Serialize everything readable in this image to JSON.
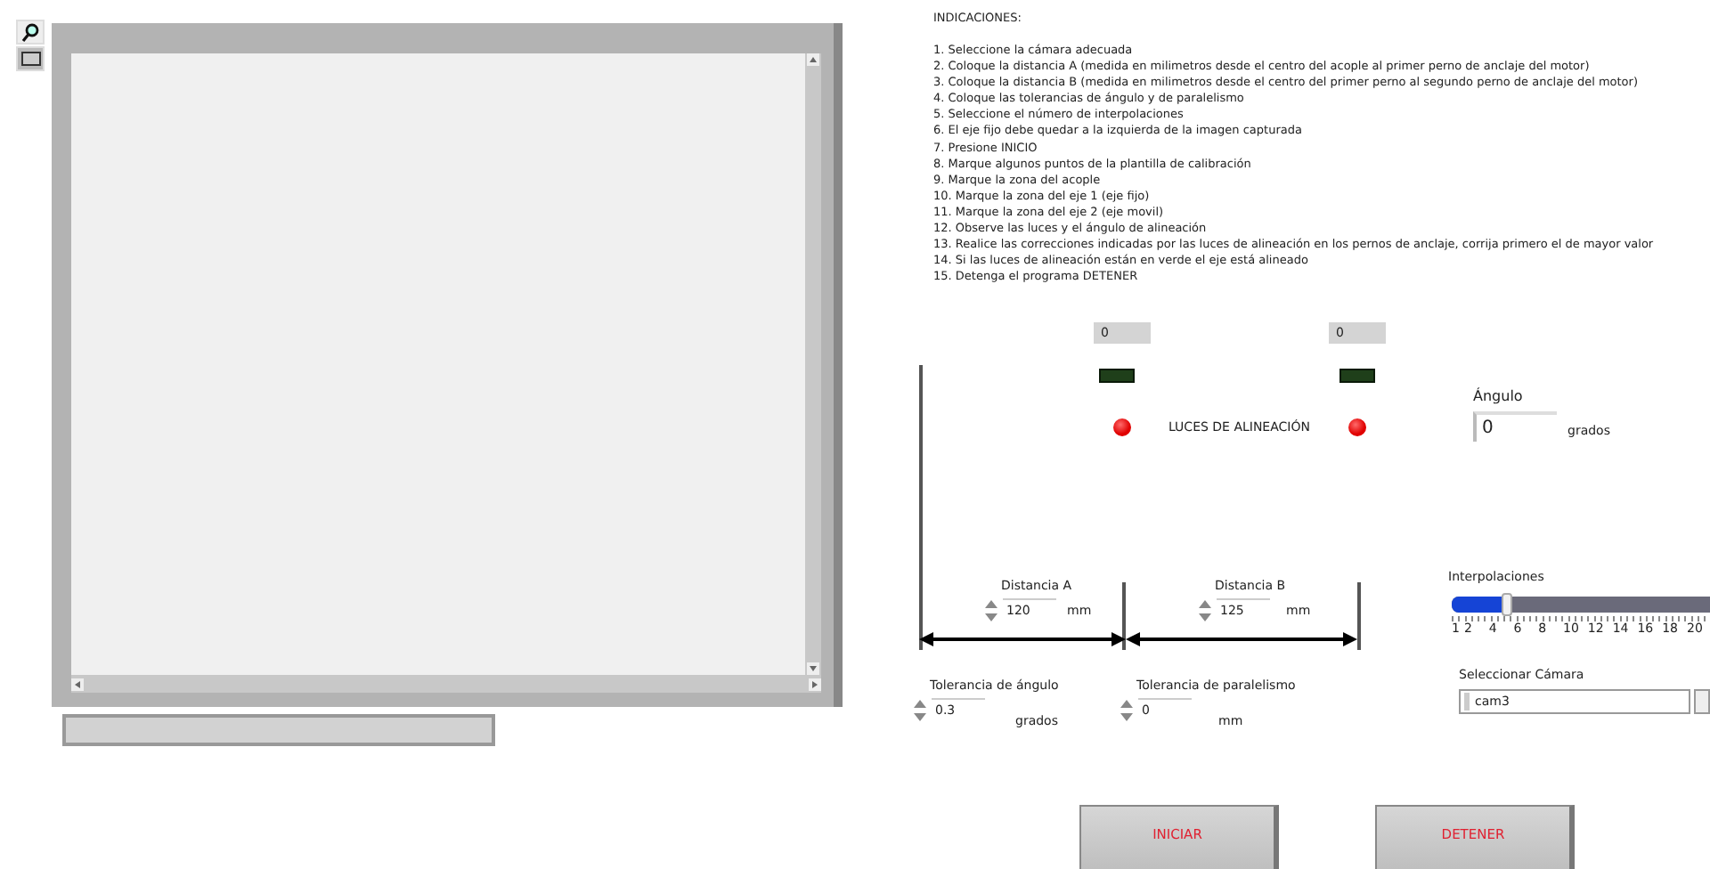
{
  "indications": {
    "title": "INDICACIONES:",
    "steps": [
      "1. Seleccione la cámara adecuada",
      "2. Coloque la distancia A (medida en milimetros desde el centro del acople al primer perno de anclaje del motor)",
      "3. Coloque la distancia B (medida en milimetros desde el centro del primer perno al segundo perno de anclaje del motor)",
      "4. Coloque las tolerancias de ángulo y de paralelismo",
      "5. Seleccione el número de interpolaciones",
      "6. El eje fijo debe quedar a la izquierda de la imagen capturada",
      "7. Presione INICIO",
      "8. Marque algunos puntos de la plantilla de calibración",
      "9. Marque la zona del acople",
      "10. Marque la zona del eje 1 (eje fijo)",
      "11. Marque la zona del eje 2 (eje movil)",
      "12. Observe las luces y el ángulo de alineación",
      "13. Realice las correcciones indicadas por las luces de alineación en los pernos de anclaje, corrija primero el de mayor valor",
      "14. Si las luces de alineación están en verde el eje está alineado",
      "15. Detenga el programa DETENER"
    ]
  },
  "indicators": [
    {
      "value": "0",
      "led_on": false
    },
    {
      "value": "0",
      "led_on": false
    }
  ],
  "alignment_lights": {
    "label": "LUCES DE ALINEACIÓN",
    "lights": [
      {
        "on": true
      },
      {
        "on": true
      }
    ]
  },
  "angle": {
    "label": "Ángulo",
    "value": "0",
    "unit": "grados"
  },
  "distance_a": {
    "label": "Distancia A",
    "value": "120",
    "unit": "mm"
  },
  "distance_b": {
    "label": "Distancia B",
    "value": "125",
    "unit": "mm"
  },
  "angle_tolerance": {
    "label": "Tolerancia de ángulo",
    "value": "0.3",
    "unit": "grados"
  },
  "parallel_tolerance": {
    "label": "Tolerancia de paralelismo",
    "value": "0",
    "unit": "mm"
  },
  "interpolations": {
    "label": "Interpolaciones",
    "level": 0.21,
    "ticks": [
      "1",
      "2",
      "4",
      "6",
      "8",
      "10",
      "12",
      "14",
      "16",
      "18",
      "20"
    ]
  },
  "camera": {
    "label": "Seleccionar Cámara",
    "value": "cam3"
  },
  "buttons": [
    "INICIAR",
    "DETENER"
  ]
}
